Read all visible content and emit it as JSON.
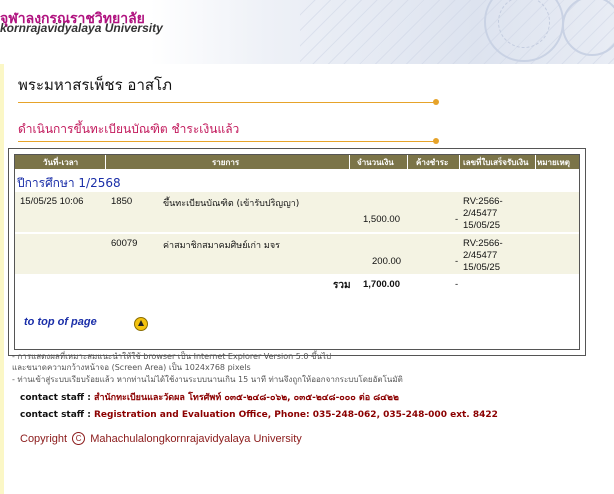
{
  "header": {
    "university_thai": "จุฬาลงกรณราชวิทยาลัย",
    "university_en": "kornrajavidyalaya University"
  },
  "student_name": "พระมหาสรเพ็ชร อาสโภ",
  "section_title": "ดำเนินการขึ้นทะเบียนบัณฑิต ชำระเงินแล้ว",
  "table": {
    "columns": [
      "วันที่-เวลา",
      "รายการ",
      "จำนวนเงิน",
      "ค้างชำระ",
      "เลขที่ใบเสร็จรับเงิน",
      "หมายเหตุ"
    ],
    "semester": "ปีการศึกษา 1/2568",
    "rows": [
      {
        "datetime": "15/05/25 10:06",
        "code": "1850",
        "item": "ขึ้นทะเบียนบัณฑิต (เข้ารับปริญญา)",
        "amount": "1,500.00",
        "outstanding": "-",
        "receipt": [
          "RV:2566-",
          "2/45477",
          "15/05/25"
        ]
      },
      {
        "datetime": "",
        "code": "60079",
        "item": "ค่าสมาชิกสมาคมศิษย์เก่า มจร",
        "amount": "200.00",
        "outstanding": "-",
        "receipt": [
          "RV:2566-",
          "2/45477",
          "15/05/25"
        ]
      }
    ],
    "total_label": "รวม",
    "total_amount": "1,700.00",
    "total_outstanding": "-"
  },
  "top_link": "to top of page",
  "notes": [
    "- การแสดงผลที่เหมาะสมแนะนำให้ใช้ browser เป็น Internet Explorer Version 5.0 ขึ้นไป",
    "  และขนาดความกว้างหน้าจอ (Screen Area) เป็น 1024x768 pixels",
    "- ท่านเข้าสู่ระบบเรียบร้อยแล้ว หากท่านไม่ได้ใช้งานระบบนานเกิน 15 นาที ท่านจึงถูกให้ออกจากระบบโดยอัตโนมัติ"
  ],
  "contact": {
    "label": "contact staff :",
    "thai": "สำนักทะเบียนและวัดผล โทรศัพท์ ๐๓๕-๒๔๘-๐๖๒, ๐๓๕-๒๔๘-๐๐๐ ต่อ ๘๔๒๒",
    "en": "Registration and Evaluation Office, Phone: 035-248-062, 035-248-000 ext. 8422"
  },
  "copyright": {
    "prefix": "Copyright",
    "symbol": "C",
    "text": "Mahachulalongkornrajavidyalaya University"
  },
  "colors": {
    "brand": "#b0127f",
    "accent": "#e6a32a",
    "table_header": "#7b7448",
    "link": "#1a2ea8"
  },
  "icons": [
    "seal-icon",
    "top-arrow-icon"
  ]
}
